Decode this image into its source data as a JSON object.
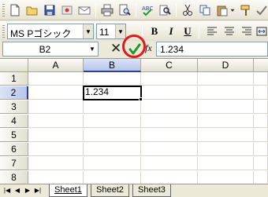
{
  "font": {
    "name": "MS Pゴシック",
    "size": "11"
  },
  "format": {
    "bold": "B",
    "italic": "I",
    "underline": "U"
  },
  "formula_bar": {
    "name_box": "B2",
    "cancel_symbol": "✕",
    "fx_label": "fx",
    "content": "1.234"
  },
  "columns": [
    "A",
    "B",
    "C",
    "D"
  ],
  "rows": [
    "1",
    "2",
    "3",
    "4",
    "5",
    "6",
    "7",
    "8"
  ],
  "active_cell": {
    "ref": "B2",
    "value": "1.234"
  },
  "sheets": [
    "Sheet1",
    "Sheet2",
    "Sheet3"
  ],
  "nav_buttons": [
    "|◀",
    "◀",
    "▶",
    "▶|"
  ],
  "colors": {
    "highlight_ring": "#e21a1a",
    "enter_check": "#1f9a2a",
    "selection_header": "#b6c6ea"
  }
}
